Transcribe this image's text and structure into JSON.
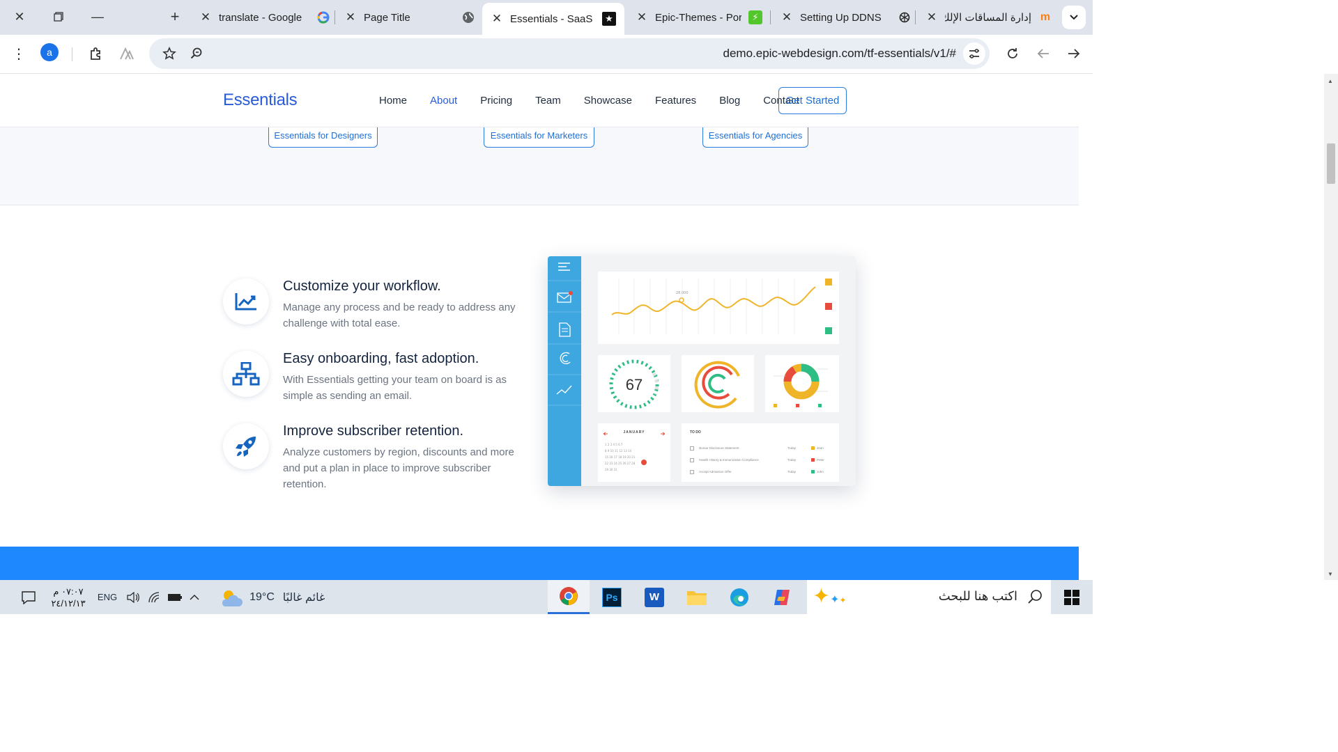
{
  "browser": {
    "tabs": [
      {
        "title": "translate - Google",
        "favicon": "google-icon"
      },
      {
        "title": "Page Title",
        "favicon": "globe-icon"
      },
      {
        "title": "Essentials - SaaS La",
        "favicon": "star-icon",
        "active": true
      },
      {
        "title": "Epic-Themes - Port",
        "favicon": "lightning-icon"
      },
      {
        "title": "Setting Up DDNS",
        "favicon": "openai-icon"
      },
      {
        "title": "إدارة المساقات الإلك",
        "favicon": "moodle-icon"
      }
    ],
    "url": "demo.epic-webdesign.com/tf-essentials/v1/#",
    "profile_initial": "a"
  },
  "site": {
    "logo": "Essentials",
    "nav": [
      "Home",
      "About",
      "Pricing",
      "Team",
      "Showcase",
      "Features",
      "Blog",
      "Contact"
    ],
    "nav_active": "About",
    "cta": "Get Started",
    "pills": [
      "Essentials for Designers",
      "Essentials for Marketers",
      "Essentials for Agencies"
    ],
    "features": [
      {
        "title": "Customize your workflow.",
        "desc": "Manage any process and be ready to address any challenge with total ease.",
        "icon": "chart-line-icon"
      },
      {
        "title": "Easy onboarding, fast adoption.",
        "desc": "With Essentials getting your team on board is as simple as sending an email.",
        "icon": "network-icon"
      },
      {
        "title": "Improve subscriber retention.",
        "desc": "Analyze customers by region, discounts and more and put a plan in place to improve subscriber retention.",
        "icon": "rocket-icon"
      }
    ],
    "dashboard": {
      "gauge_value": "67",
      "calendar_month": "JANUARY",
      "todo_title": "TO DO",
      "todos": [
        {
          "task": "Bursar Disclosure Statement",
          "when": "Today",
          "who": "Jean"
        },
        {
          "task": "Health History & Immunization Compliance",
          "when": "Today",
          "who": "Peter"
        },
        {
          "task": "Accept Admission Offer",
          "when": "Today",
          "who": "John"
        }
      ],
      "legend": [
        "Jean",
        "Peter",
        "John"
      ],
      "chart_peak_label": "28,000"
    }
  },
  "taskbar": {
    "search_placeholder": "اكتب هنا للبحث",
    "weather_temp": "19°C",
    "weather_text": "غائم غالبًا",
    "lang": "ENG",
    "time": "٠٧:٠٧ م",
    "date": "٢٤/١٢/١٣"
  },
  "colors": {
    "brand": "#2a5bd7",
    "accent": "#1e88ff",
    "sidebar": "#3fa7e0"
  }
}
